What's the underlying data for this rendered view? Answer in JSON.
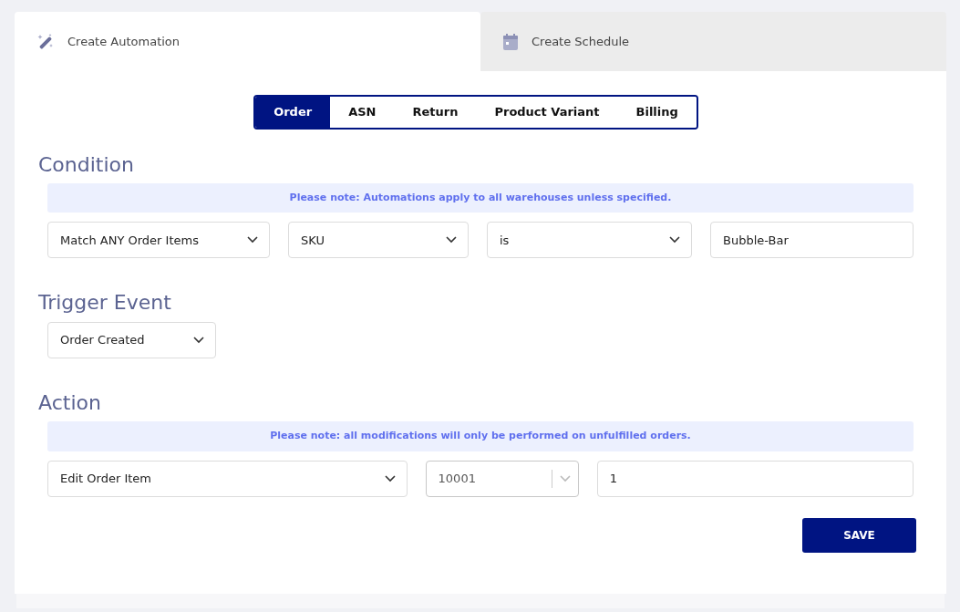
{
  "tabs": [
    {
      "label": "Create Automation",
      "selected": true
    },
    {
      "label": "Create Schedule",
      "selected": false
    }
  ],
  "segments": [
    {
      "label": "Order",
      "selected": true
    },
    {
      "label": "ASN",
      "selected": false
    },
    {
      "label": "Return",
      "selected": false
    },
    {
      "label": "Product Variant",
      "selected": false
    },
    {
      "label": "Billing",
      "selected": false
    }
  ],
  "sections": [
    {
      "title": "Condition",
      "note": "Please note: Automations apply to all warehouses unless specified.",
      "fields": [
        {
          "kind": "select",
          "value": "Match ANY Order Items"
        },
        {
          "kind": "select",
          "value": "SKU"
        },
        {
          "kind": "select",
          "value": "is"
        },
        {
          "kind": "input",
          "value": "Bubble-Bar"
        }
      ]
    },
    {
      "title": "Trigger Event",
      "fields": [
        {
          "kind": "select",
          "value": "Order Created"
        }
      ]
    },
    {
      "title": "Action",
      "note": "Please note: all modifications will only be performed on unfulfilled orders.",
      "fields": [
        {
          "kind": "select",
          "value": "Edit Order Item"
        },
        {
          "kind": "combo",
          "value": "10001"
        },
        {
          "kind": "input",
          "value": "1"
        }
      ]
    }
  ],
  "save_button": "SAVE"
}
